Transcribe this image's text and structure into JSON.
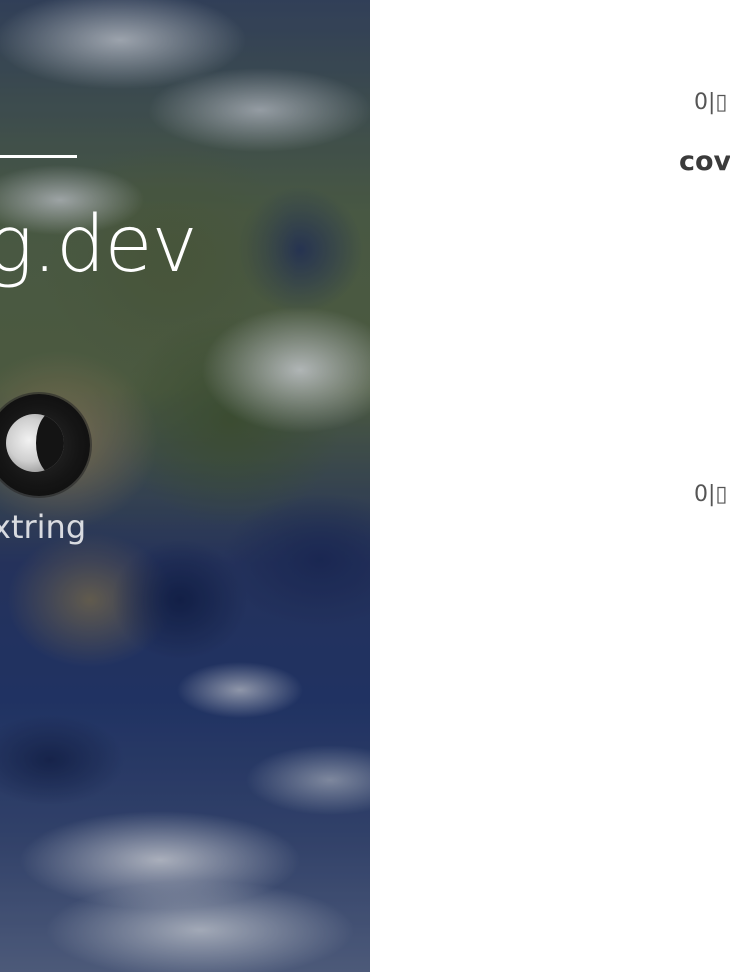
{
  "hero": {
    "title": "ng.dev",
    "name": "xtring"
  },
  "posts": [
    {
      "meta": "0|▯",
      "title": "cov"
    },
    {
      "meta": "0|▯"
    }
  ],
  "icons": {
    "avatar": "moon-avatar-icon"
  },
  "colors": {
    "hero_text": "#ffffff",
    "meta_text": "#555555",
    "title_text": "#3b3b3b",
    "background": "#ffffff"
  }
}
